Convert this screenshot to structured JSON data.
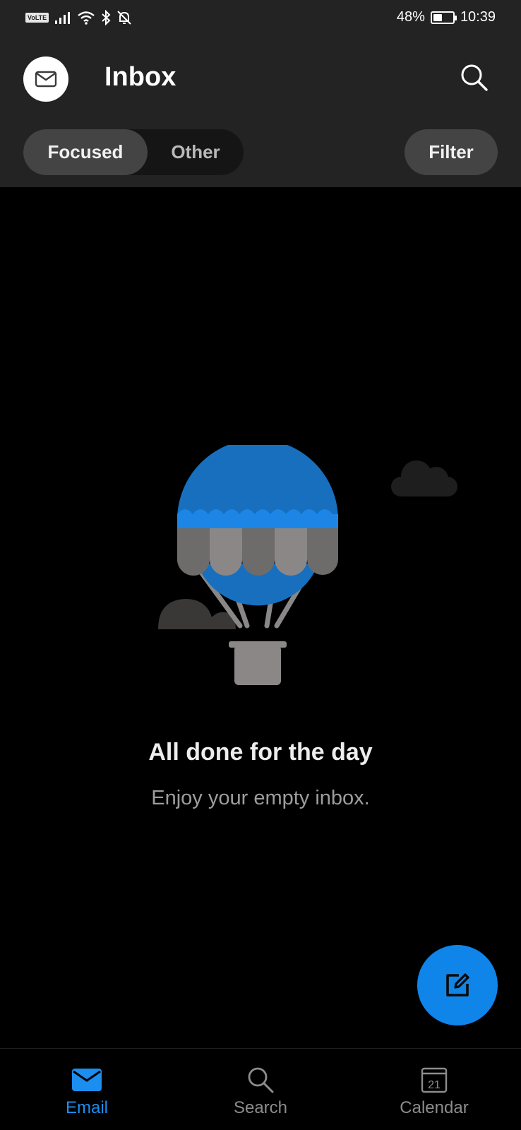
{
  "status_bar": {
    "volte": "VoLTE",
    "battery_percent": "48%",
    "battery_level": 0.48,
    "time": "10:39"
  },
  "header": {
    "title": "Inbox",
    "tabs": [
      {
        "label": "Focused",
        "selected": true
      },
      {
        "label": "Other",
        "selected": false
      }
    ],
    "filter_label": "Filter"
  },
  "empty_state": {
    "title": "All done for the day",
    "subtitle": "Enjoy your empty inbox."
  },
  "bottom_nav": {
    "items": [
      {
        "label": "Email",
        "icon": "mail-icon",
        "active": true
      },
      {
        "label": "Search",
        "icon": "search-icon",
        "active": false
      },
      {
        "label": "Calendar",
        "icon": "calendar-icon",
        "active": false,
        "day": "21"
      }
    ]
  },
  "colors": {
    "accent": "#0f85ea",
    "header_bg": "#232323",
    "background": "#000000"
  }
}
